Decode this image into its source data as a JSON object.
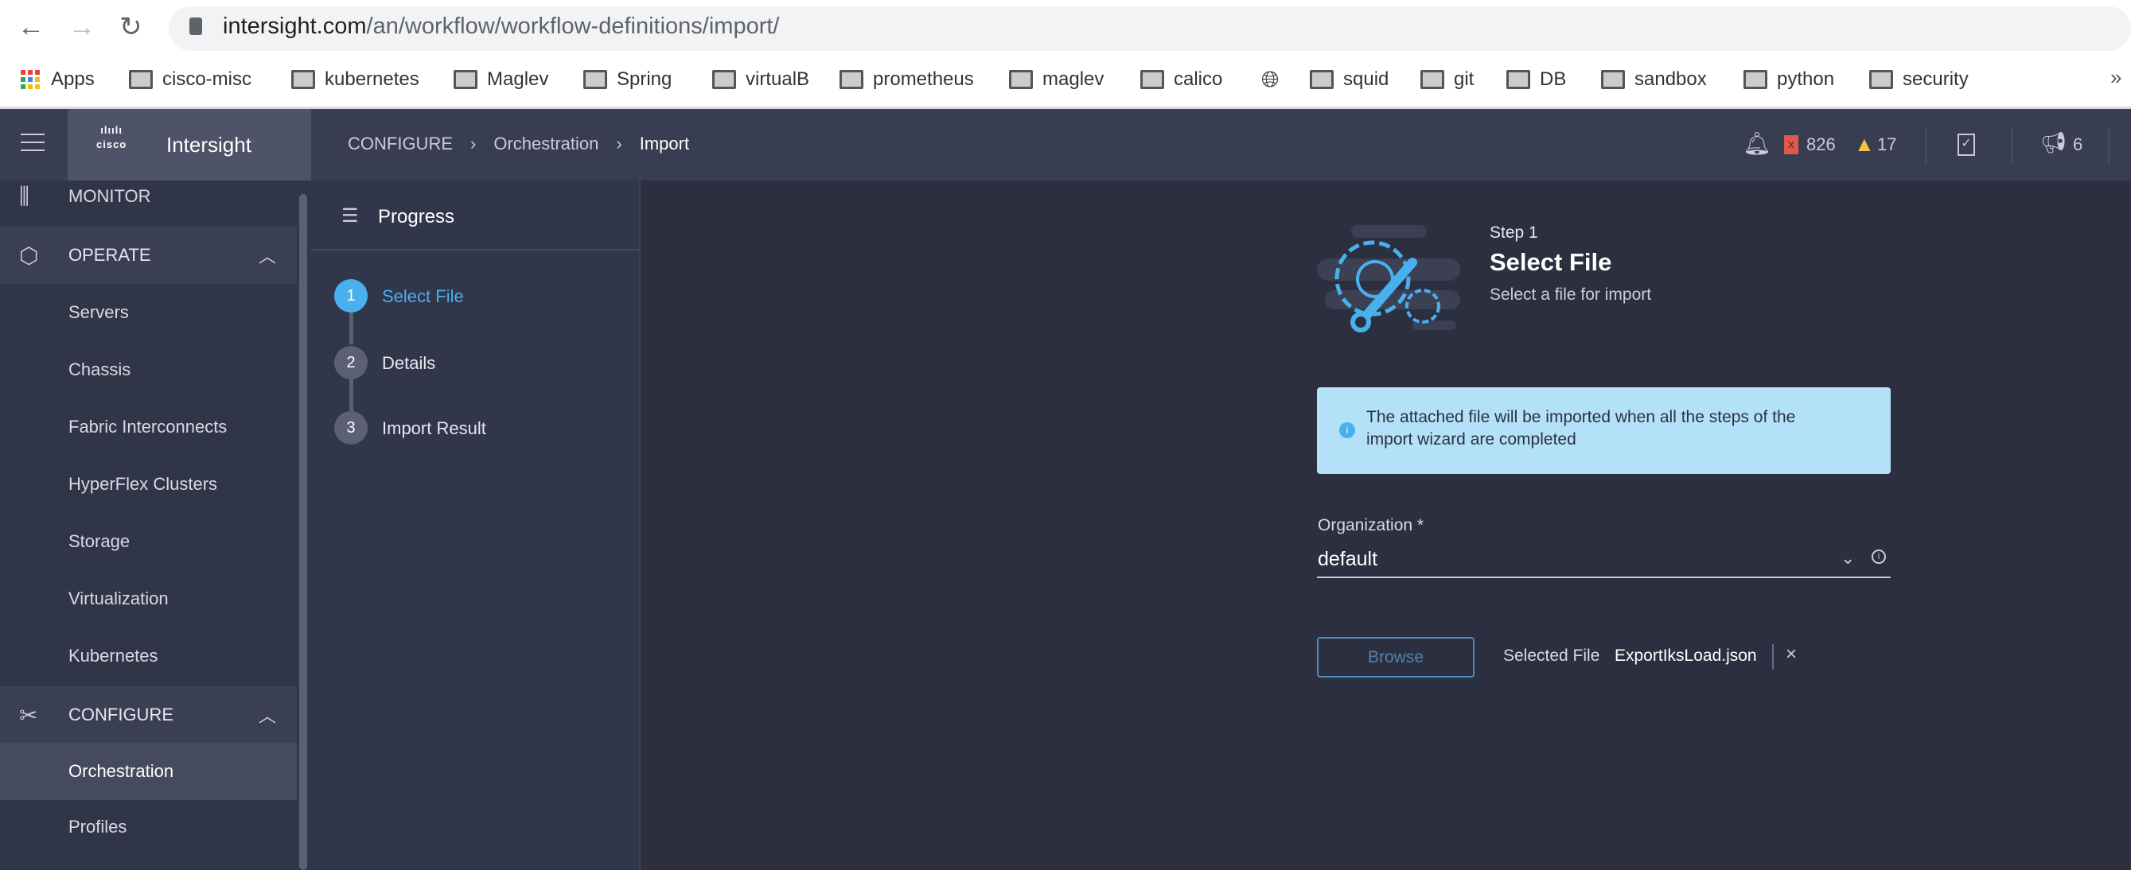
{
  "browser": {
    "url_host": "intersight.com",
    "url_path": "/an/workflow/workflow-definitions/import/",
    "overflow": "»",
    "bookmarks": [
      "Apps",
      "cisco-misc",
      "kubernetes",
      "Maglev",
      "Spring",
      "virtualB",
      "prometheus",
      "maglev",
      "calico",
      "",
      "squid",
      "git",
      "DB",
      "sandbox",
      "python",
      "security"
    ]
  },
  "header": {
    "brand": "Intersight",
    "logo": "cisco",
    "breadcrumb": [
      "CONFIGURE",
      "Orchestration",
      "Import"
    ],
    "alarms_critical": "826",
    "alarms_warning": "17",
    "announcements": "6"
  },
  "sidebar": {
    "monitor": "MONITOR",
    "operate": "OPERATE",
    "operate_items": [
      "Servers",
      "Chassis",
      "Fabric Interconnects",
      "HyperFlex Clusters",
      "Storage",
      "Virtualization",
      "Kubernetes"
    ],
    "configure": "CONFIGURE",
    "configure_items": [
      "Orchestration",
      "Profiles"
    ]
  },
  "progress": {
    "title": "Progress",
    "steps": [
      {
        "num": "1",
        "label": "Select File",
        "active": true
      },
      {
        "num": "2",
        "label": "Details"
      },
      {
        "num": "3",
        "label": "Import Result"
      }
    ]
  },
  "main": {
    "step": "Step 1",
    "title": "Select File",
    "subtitle": "Select a file for import",
    "info": "The attached file will be imported when all the steps of the import wizard are completed",
    "org_label": "Organization *",
    "org_value": "default",
    "browse": "Browse",
    "selected_label": "Selected File",
    "selected_file": "ExportIksLoad.json"
  },
  "colors": {
    "accent": "#49b0ee",
    "critical": "#e2574c",
    "warning": "#f5c342"
  }
}
